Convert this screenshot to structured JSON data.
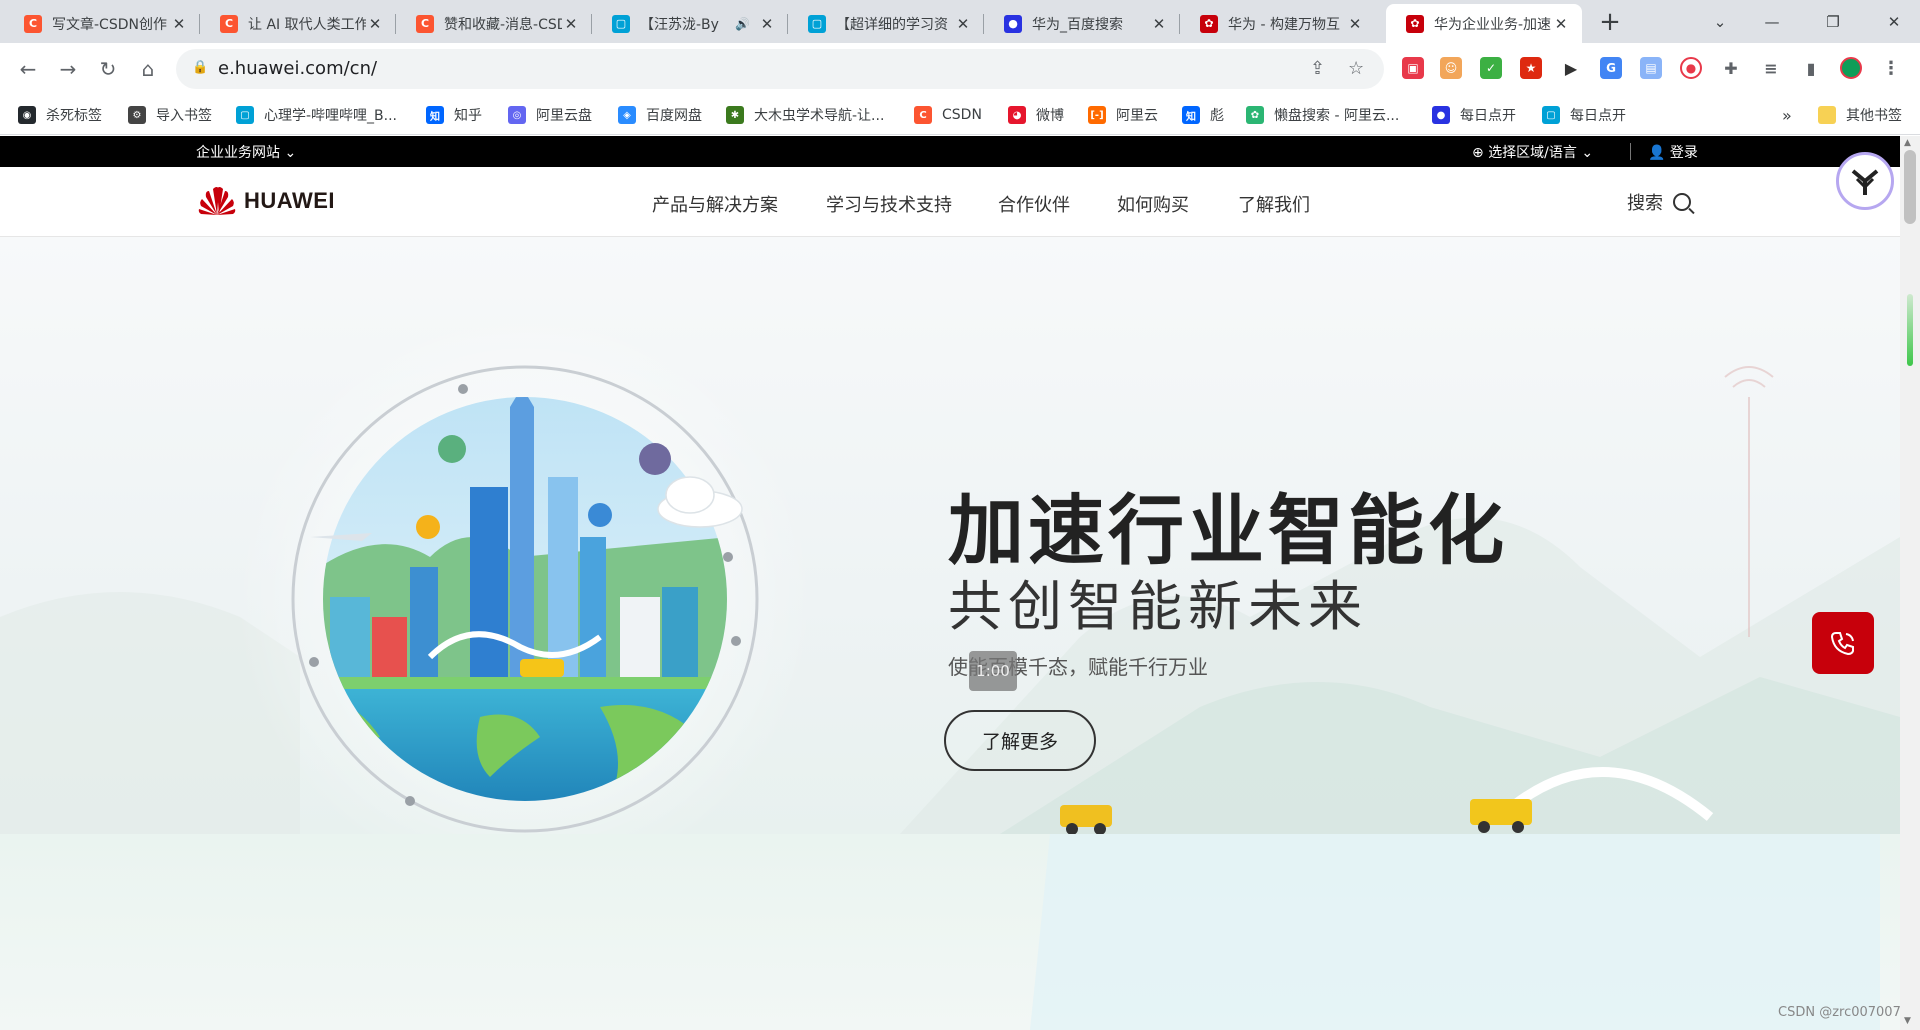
{
  "browser": {
    "tabs": [
      {
        "title": "写文章-CSDN创作",
        "favicon": "csdn-icon",
        "active": false
      },
      {
        "title": "让 AI 取代人类工作",
        "favicon": "csdn-icon",
        "active": false
      },
      {
        "title": "赞和收藏-消息-CSDN",
        "favicon": "csdn-icon",
        "active": false
      },
      {
        "title": "【汪苏泷-By",
        "favicon": "bilibili-icon",
        "active": false,
        "muted": true
      },
      {
        "title": "【超详细的学习资",
        "favicon": "bilibili-icon",
        "active": false
      },
      {
        "title": "华为_百度搜索",
        "favicon": "baidu-icon",
        "active": false
      },
      {
        "title": "华为 - 构建万物互",
        "favicon": "huawei-icon",
        "active": false
      },
      {
        "title": "华为企业业务-加速",
        "favicon": "huawei-icon",
        "active": true
      }
    ],
    "address": "e.huawei.com/cn/",
    "bookmarks": [
      {
        "label": "杀死标签",
        "icon": "github-icon",
        "color": "#24292e"
      },
      {
        "label": "导入书签",
        "icon": "gear-icon",
        "color": "#444444"
      },
      {
        "label": "心理学-哔哩哔哩_B...",
        "icon": "bilibili-icon",
        "color": "#00a1d6"
      },
      {
        "label": "知乎",
        "icon": "zhihu-icon",
        "color": "#0066ff"
      },
      {
        "label": "阿里云盘",
        "icon": "aliyun-drive-icon",
        "color": "#6366f1"
      },
      {
        "label": "百度网盘",
        "icon": "baidu-drive-icon",
        "color": "#2a8cff"
      },
      {
        "label": "大木虫学术导航-让...",
        "icon": "bug-icon",
        "color": "#3b7a1e"
      },
      {
        "label": "CSDN",
        "icon": "csdn-icon",
        "color": "#fc5531"
      },
      {
        "label": "微博",
        "icon": "weibo-icon",
        "color": "#e6162d"
      },
      {
        "label": "阿里云",
        "icon": "aliyun-icon",
        "color": "#ff6a00"
      },
      {
        "label": "彪",
        "icon": "zhihu-icon",
        "color": "#0066ff"
      },
      {
        "label": "懒盘搜索 - 阿里云...",
        "icon": "flower-icon",
        "color": "#2bb673"
      },
      {
        "label": "每日点开",
        "icon": "baidu-icon",
        "color": "#2932e1"
      },
      {
        "label": "每日点开",
        "icon": "bilibili-icon",
        "color": "#00a1d6"
      }
    ],
    "bookmarks_more": "»",
    "other_bookmarks": "其他书签"
  },
  "site": {
    "topbar": {
      "site_switch": "企业业务网站 ⌄",
      "region": "选择区域/语言 ⌄",
      "login": "登录"
    },
    "logo_text": "HUAWEI",
    "nav": [
      "产品与解决方案",
      "学习与技术支持",
      "合作伙伴",
      "如何购买",
      "了解我们"
    ],
    "search_label": "搜索",
    "hero": {
      "title": "加速行业智能化",
      "subtitle": "共创智能新未来",
      "description": "使能百模千态，赋能千行万业",
      "cta": "了解更多",
      "overlay_text": "1:00"
    },
    "brand_red": "#c7000b"
  },
  "watermark": "CSDN @zrc007007"
}
